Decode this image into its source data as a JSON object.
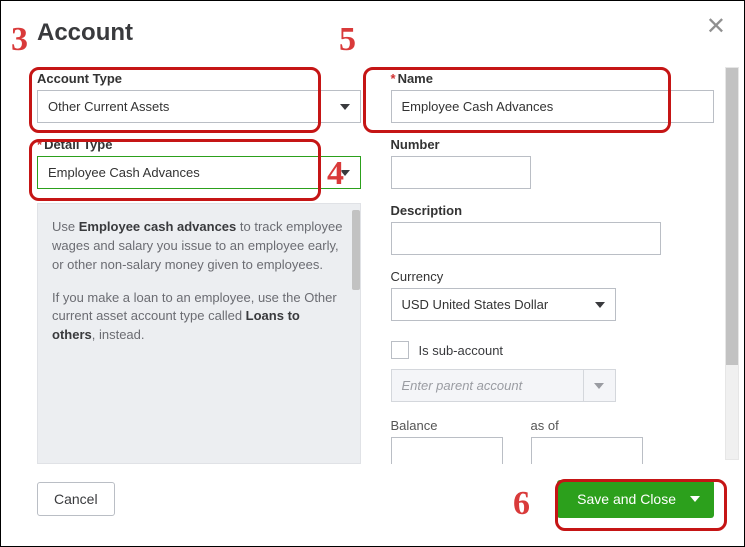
{
  "title": "Account",
  "close_icon": "✕",
  "left": {
    "accountType": {
      "label": "Account Type",
      "value": "Other Current Assets"
    },
    "detailType": {
      "label": "Detail Type",
      "value": "Employee Cash Advances"
    },
    "help": {
      "p1a": "Use ",
      "p1b": "Employee cash advances",
      "p1c": " to track employee wages and salary you issue to an employee early, or other non-salary money given to employees.",
      "p2a": "If you make a loan to an employee, use the Other current asset account type called ",
      "p2b": "Loans to others",
      "p2c": ", instead."
    }
  },
  "right": {
    "name": {
      "label": "Name",
      "value": "Employee Cash Advances"
    },
    "number": {
      "label": "Number",
      "value": ""
    },
    "description": {
      "label": "Description",
      "value": ""
    },
    "currency": {
      "label": "Currency",
      "value": "USD United States Dollar"
    },
    "isSub": {
      "label": "Is sub-account"
    },
    "parent": {
      "placeholder": "Enter parent account"
    },
    "balance": {
      "label": "Balance",
      "value": ""
    },
    "asOf": {
      "label": "as of",
      "value": ""
    }
  },
  "footer": {
    "cancel": "Cancel",
    "save": "Save and Close"
  },
  "annotations": {
    "n3": "3",
    "n4": "4",
    "n5": "5",
    "n6": "6"
  }
}
